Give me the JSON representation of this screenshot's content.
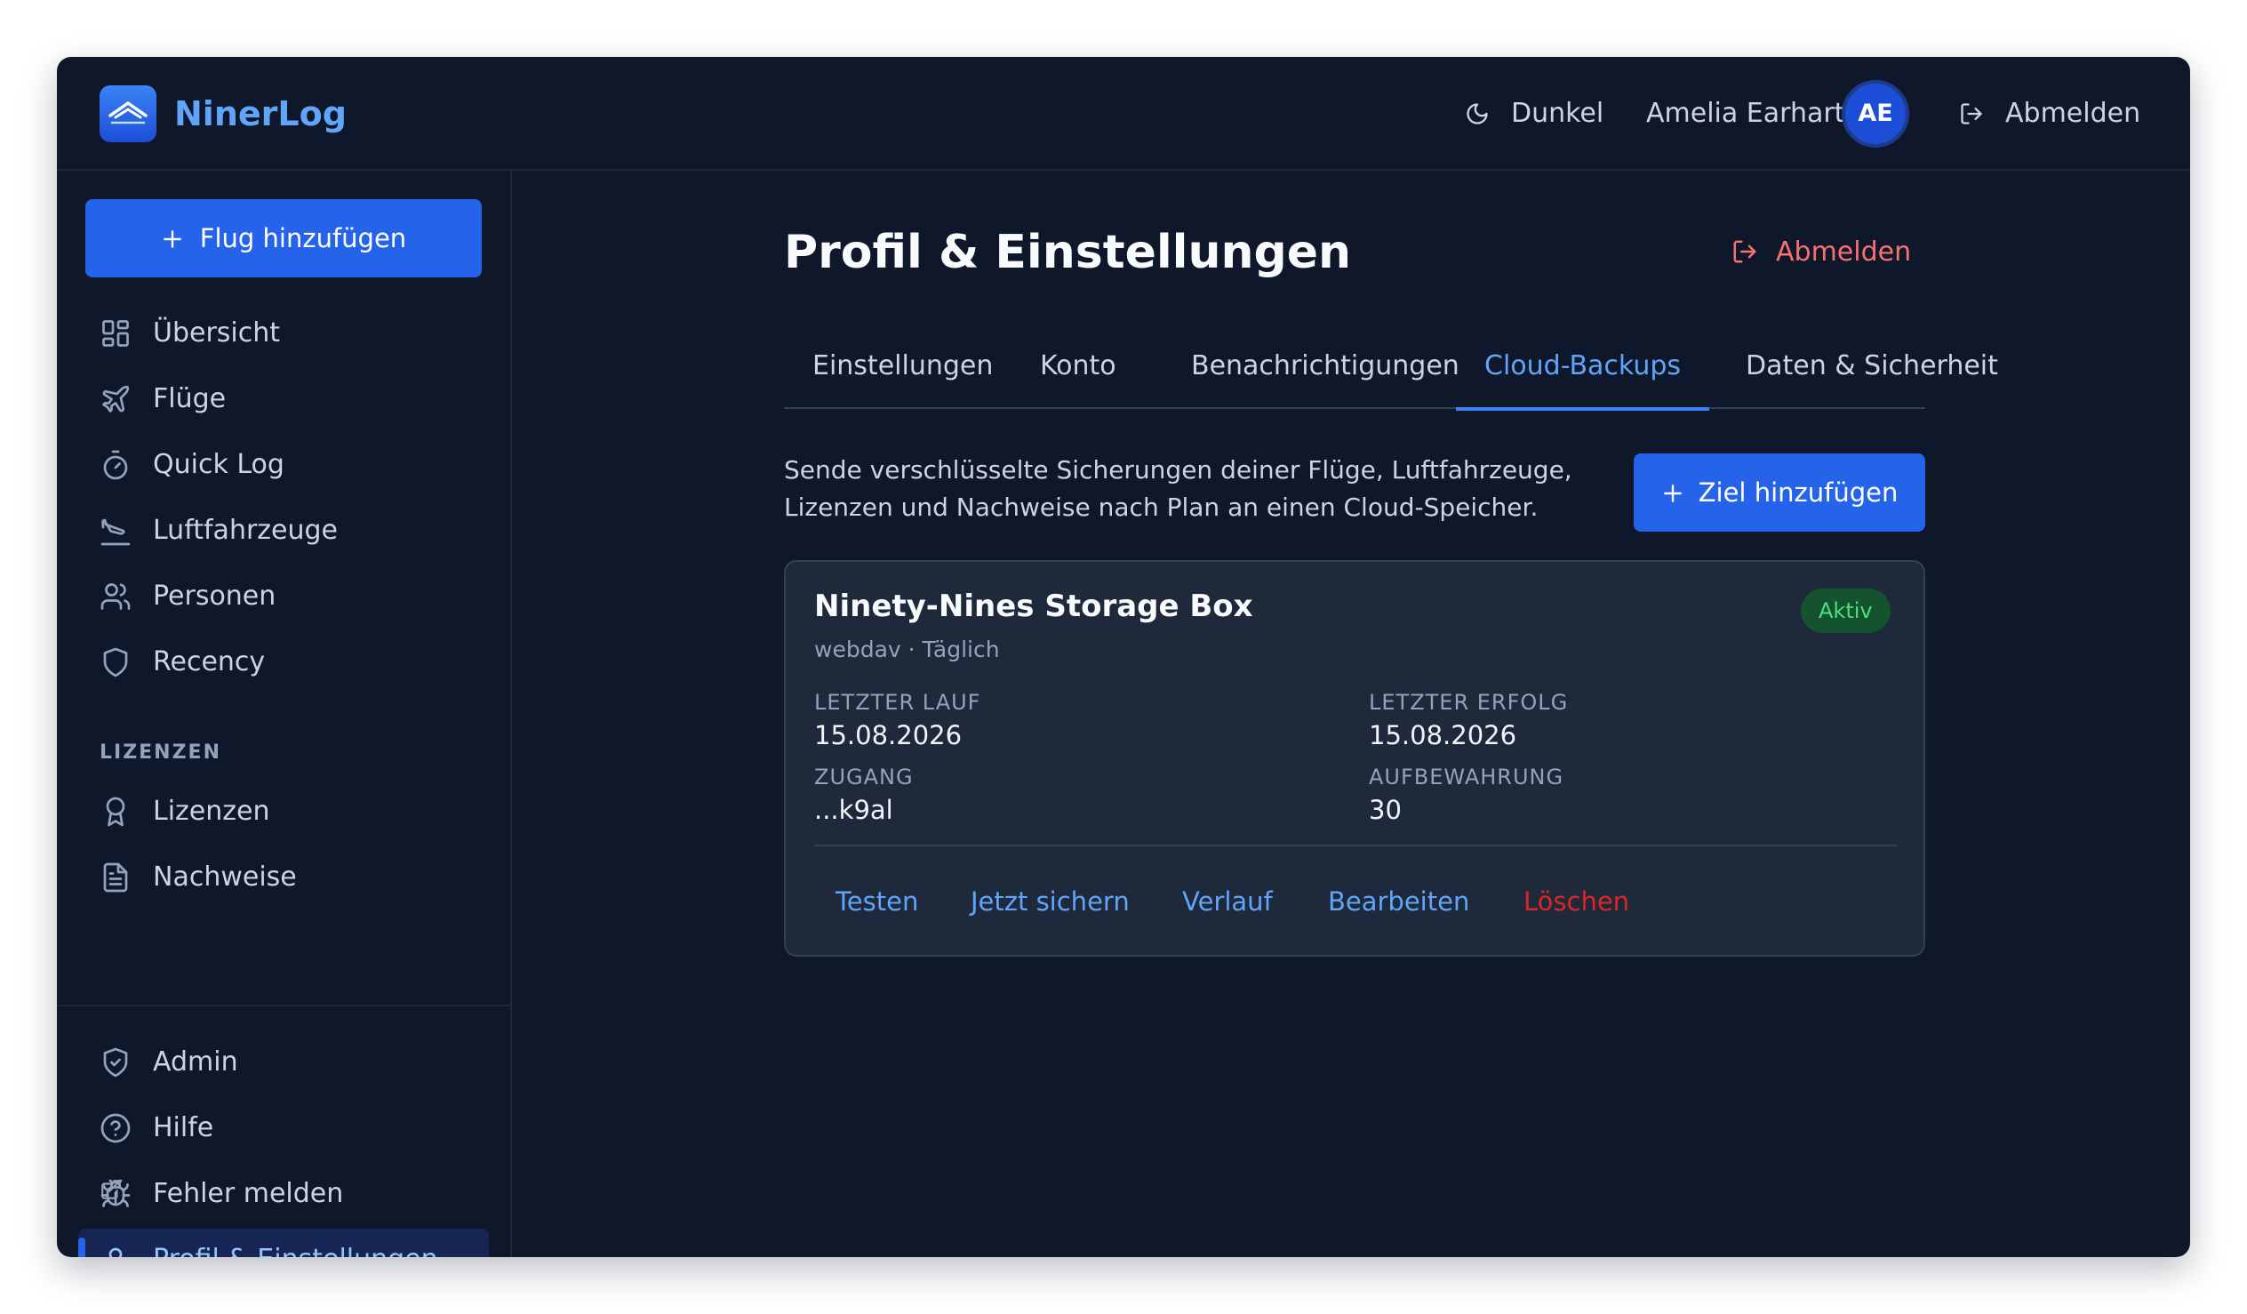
{
  "app": {
    "name": "NinerLog"
  },
  "header": {
    "theme_label": "Dunkel",
    "user_name": "Amelia Earhart",
    "user_initials": "AE",
    "logout_label": "Abmelden"
  },
  "sidebar": {
    "add_flight_label": "Flug hinzufügen",
    "items": [
      {
        "label": "Übersicht",
        "icon": "dashboard-icon"
      },
      {
        "label": "Flüge",
        "icon": "plane-icon"
      },
      {
        "label": "Quick Log",
        "icon": "stopwatch-icon"
      },
      {
        "label": "Luftfahrzeuge",
        "icon": "plane-landing-icon"
      },
      {
        "label": "Personen",
        "icon": "users-icon"
      },
      {
        "label": "Recency",
        "icon": "shield-icon"
      }
    ],
    "section_label": "LIZENZEN",
    "license_items": [
      {
        "label": "Lizenzen",
        "icon": "award-icon"
      },
      {
        "label": "Nachweise",
        "icon": "document-icon"
      }
    ],
    "bottom_items": [
      {
        "label": "Admin",
        "icon": "shield-check-icon"
      },
      {
        "label": "Hilfe",
        "icon": "help-icon"
      },
      {
        "label": "Fehler melden",
        "icon": "bug-icon",
        "external": true
      },
      {
        "label": "Profil & Einstellungen",
        "icon": "user-icon",
        "active": true
      }
    ]
  },
  "main": {
    "title": "Profil & Einstellungen",
    "logout_label": "Abmelden",
    "tabs": [
      {
        "label": "Einstellungen"
      },
      {
        "label": "Konto"
      },
      {
        "label": "Benachrichtigungen"
      },
      {
        "label": "Cloud-Backups",
        "active": true
      },
      {
        "label": "Daten & Sicherheit"
      }
    ],
    "description": "Sende verschlüsselte Sicherungen deiner Flüge, Luftfahrzeuge, Lizenzen und Nachweise nach Plan an einen Cloud-Speicher.",
    "add_target_label": "Ziel hinzufügen",
    "card": {
      "title": "Ninety-Nines Storage Box",
      "subtitle": "webdav · Täglich",
      "status": "Aktiv",
      "fields": [
        {
          "label": "LETZTER LAUF",
          "value": "15.08.2026"
        },
        {
          "label": "LETZTER ERFOLG",
          "value": "15.08.2026"
        },
        {
          "label": "ZUGANG",
          "value": "...k9al"
        },
        {
          "label": "AUFBEWAHRUNG",
          "value": "30"
        }
      ],
      "actions": [
        {
          "label": "Testen"
        },
        {
          "label": "Jetzt sichern"
        },
        {
          "label": "Verlauf"
        },
        {
          "label": "Bearbeiten"
        },
        {
          "label": "Löschen",
          "danger": true
        }
      ]
    }
  },
  "colors": {
    "background": "#0f172a",
    "accent": "#2563eb",
    "link": "#60a5fa",
    "danger": "#dc2626",
    "success": "#4ade80"
  }
}
